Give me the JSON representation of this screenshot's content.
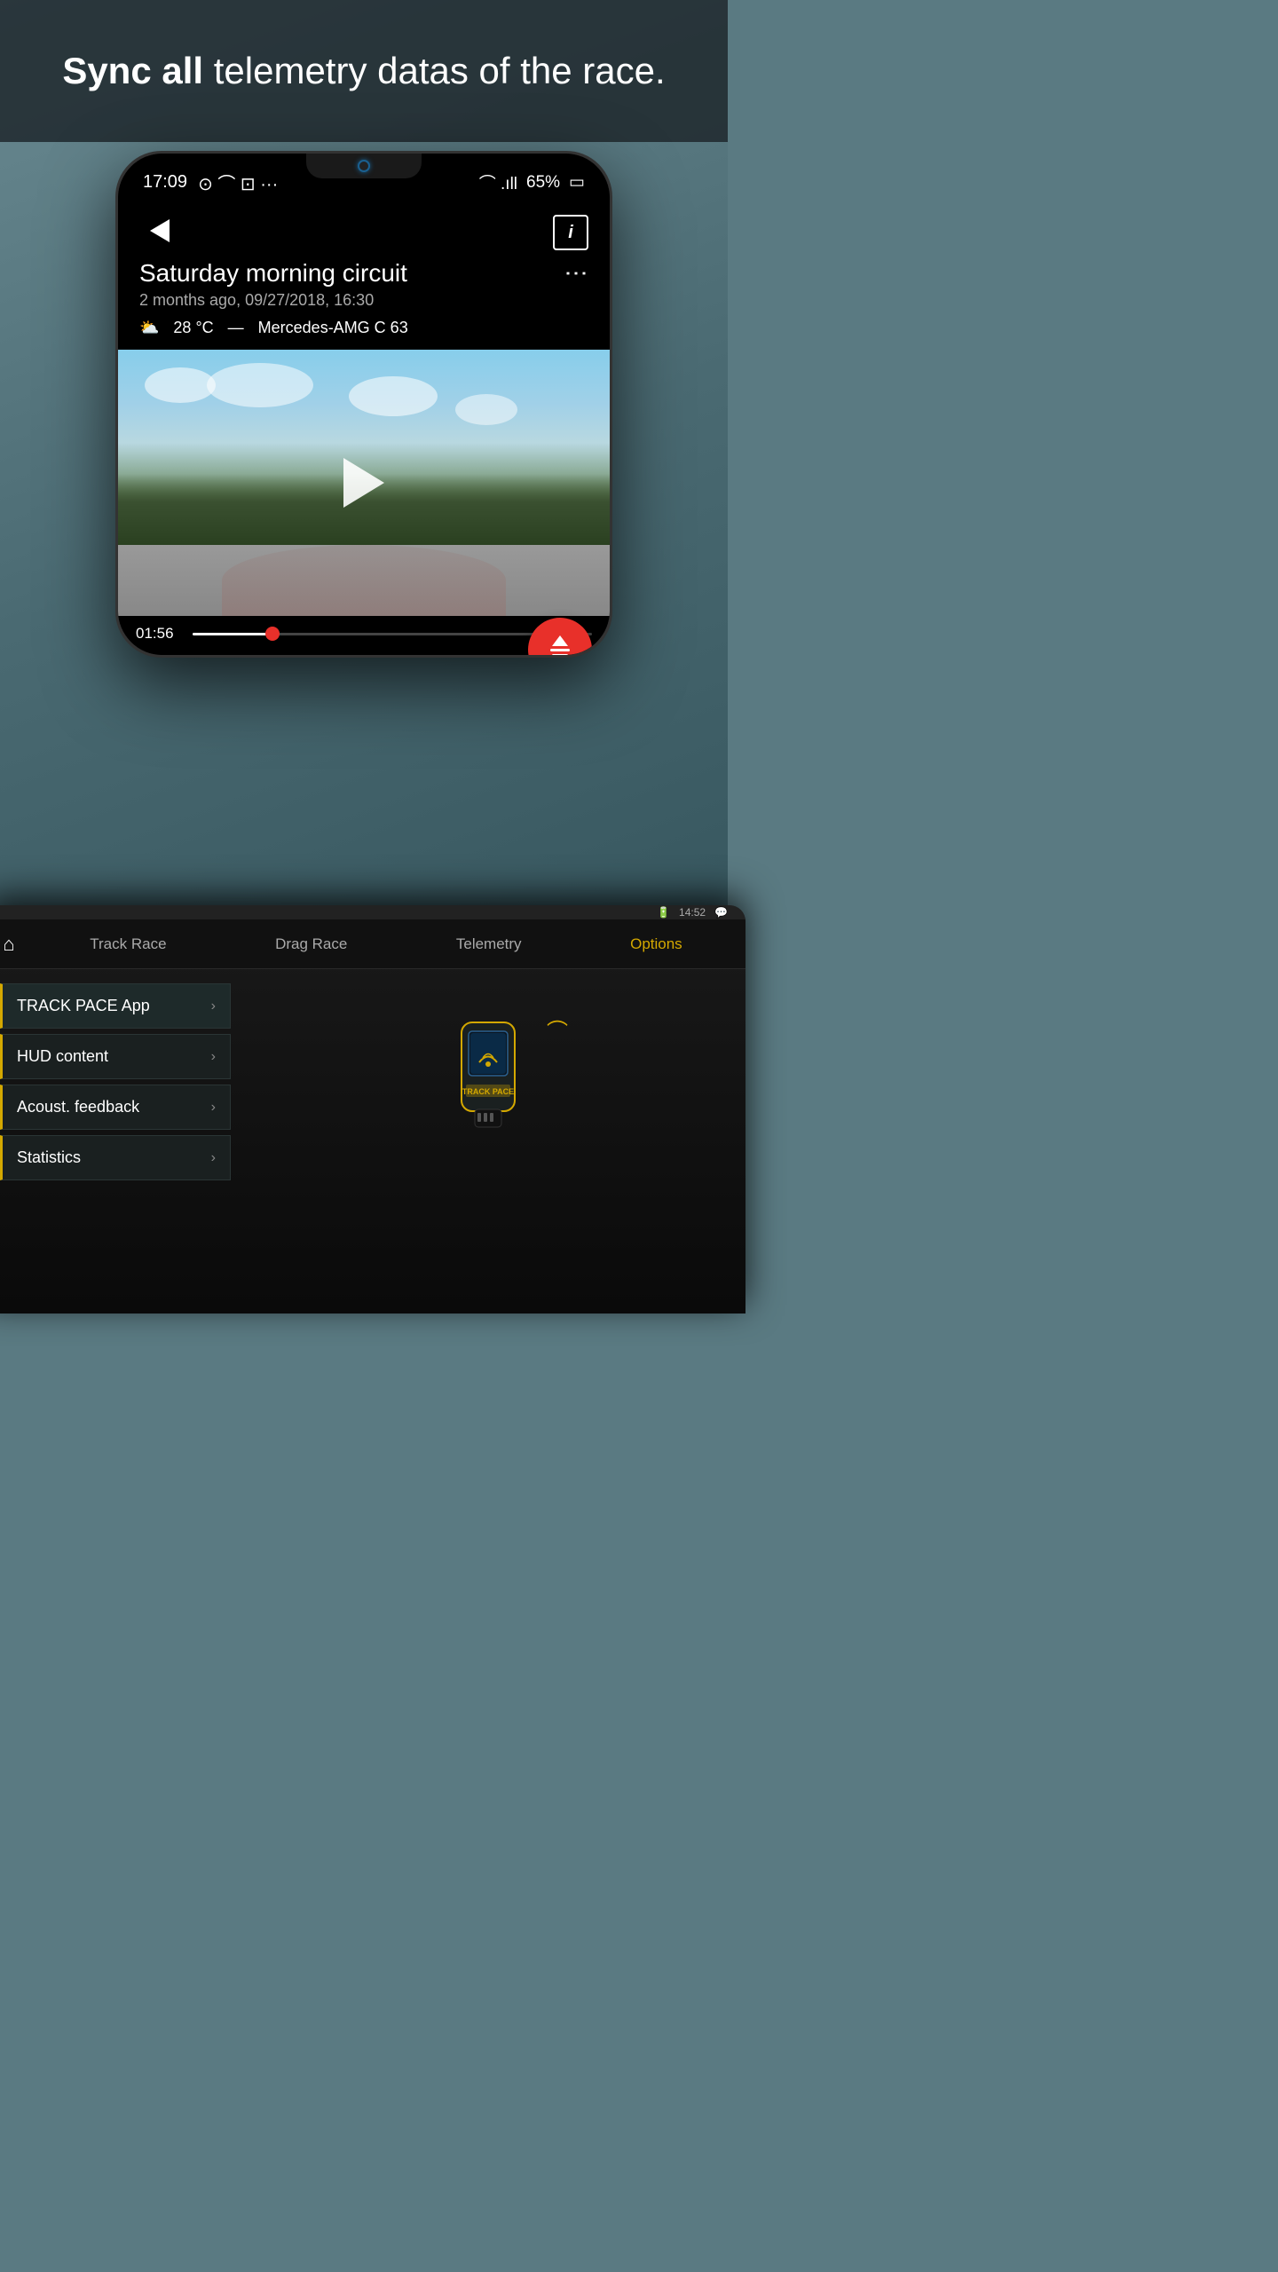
{
  "headline": {
    "prefix": "Sync all",
    "suffix": " telemetry datas of the race."
  },
  "phone": {
    "status_bar": {
      "time": "17:09",
      "battery": "65%",
      "icons_left": "⊙ ⌒ ⊡ ···",
      "icons_right": "⌒ .ill 65%"
    },
    "header": {
      "back_label": "←",
      "info_label": "i"
    },
    "session": {
      "title": "Saturday morning circuit",
      "date": "2 months ago, 09/27/2018, 16:30",
      "temperature": "28 °C",
      "car": "Mercedes-AMG C 63"
    },
    "video": {
      "timestamp": "01:56",
      "play_label": "▶"
    }
  },
  "tablet": {
    "status": {
      "time": "14:52",
      "icon": "💬"
    },
    "nav": {
      "home_icon": "⌂",
      "tabs": [
        {
          "label": "Track Race",
          "active": false
        },
        {
          "label": "Drag Race",
          "active": false
        },
        {
          "label": "Telemetry",
          "active": false
        },
        {
          "label": "Options",
          "active": true
        }
      ]
    },
    "menu_items": [
      {
        "label": "TRACK PACE App",
        "active": true
      },
      {
        "label": "HUD content",
        "active": false
      },
      {
        "label": "Acoust. feedback",
        "active": false
      },
      {
        "label": "Statistics",
        "active": false
      }
    ]
  }
}
